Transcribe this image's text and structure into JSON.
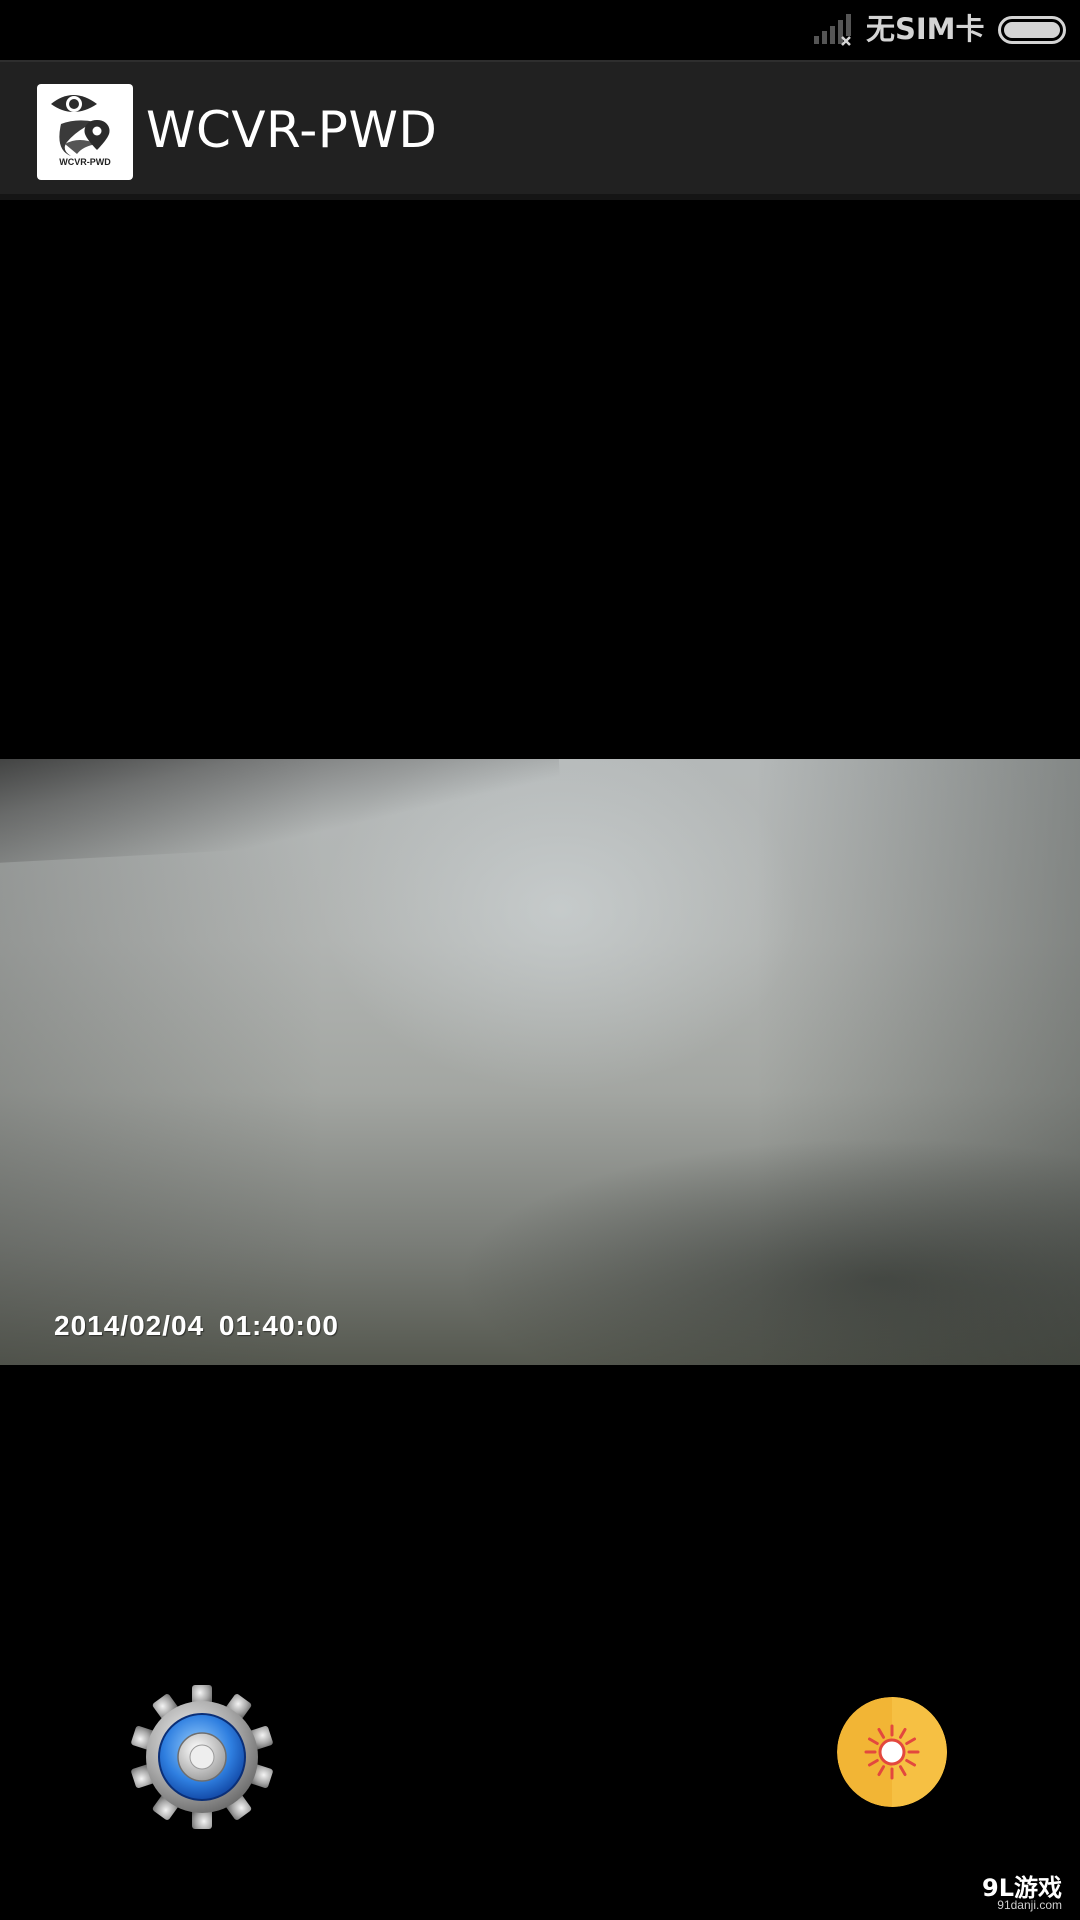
{
  "status_bar": {
    "carrier": "无SIM卡",
    "signal_icon": "no-signal-icon",
    "battery_icon": "battery-full-icon"
  },
  "action_bar": {
    "app_logo_icon": "eye-map-pin-logo",
    "logo_text": "WCVR-PWD",
    "title": "WCVR-PWD",
    "background": "#212121"
  },
  "preview": {
    "timestamp": "2014/02/04  01:40:00"
  },
  "controls": {
    "settings_icon": "gear-icon",
    "capture_icon": "sun-icon",
    "capture_color": "#F2B535"
  },
  "watermark": {
    "logo": "9L游戏",
    "url": "91danji.com"
  }
}
